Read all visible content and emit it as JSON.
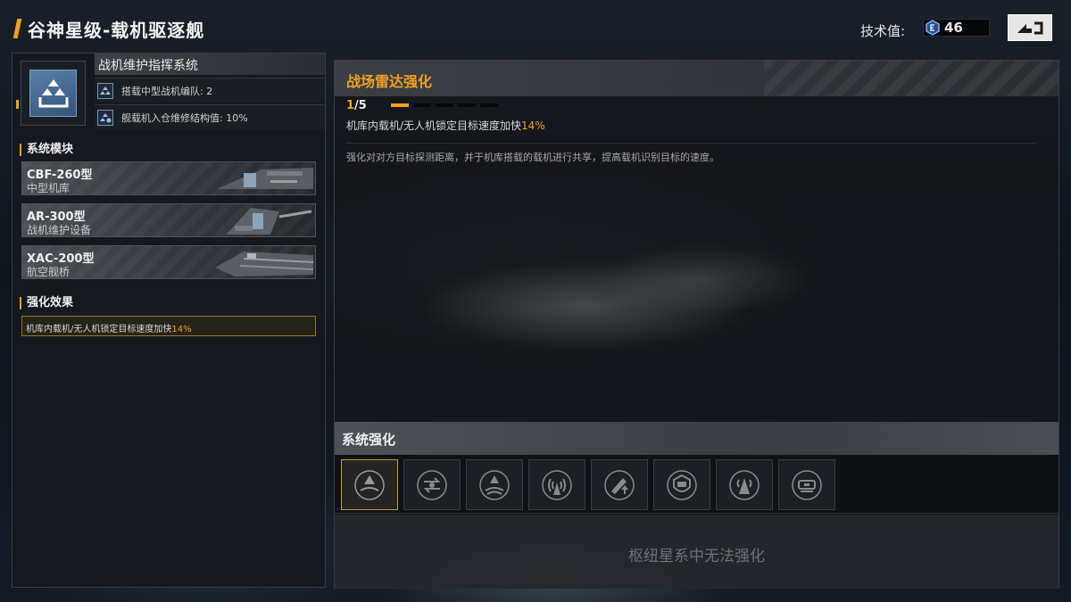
{
  "header": {
    "title": "谷神星级-载机驱逐舰",
    "tech_label": "技术值:",
    "tech_value": "46"
  },
  "system": {
    "name": "战机维护指挥系统",
    "stats": [
      "搭载中型战机编队: 2",
      "舰载机入仓维修结构值: 10%"
    ]
  },
  "sections": {
    "modules": "系统模块",
    "effects": "强化效果"
  },
  "modules": [
    {
      "name": "CBF-260型",
      "type": "中型机库"
    },
    {
      "name": "AR-300型",
      "type": "战机维护设备"
    },
    {
      "name": "XAC-200型",
      "type": "航空舰桥"
    }
  ],
  "effect_summary": {
    "text": "机库内载机/无人机锁定目标速度加快",
    "value": "14%"
  },
  "upgrade": {
    "title": "战场雷达强化",
    "level_current": "1",
    "level_max_label": "/5",
    "level_progress": 0.2,
    "effect_text": "机库内载机/无人机锁定目标速度加快",
    "effect_value": "14%",
    "description": "强化对对方目标探测距离，并于机库搭载的载机进行共享，提高载机识别目标的速度。"
  },
  "enhancement": {
    "title": "系统强化",
    "slot_icons": [
      "radar-boost-icon",
      "sync-icon",
      "lock-on-icon",
      "antenna-icon",
      "strike-up-icon",
      "shield-repair-icon",
      "beacon-icon",
      "vehicle-icon"
    ],
    "selected_index": 0,
    "locked_message": "枢纽星系中无法强化"
  },
  "colors": {
    "accent": "#f0a020",
    "panel": "#16191e",
    "icon_tile": "#4a6e96"
  }
}
